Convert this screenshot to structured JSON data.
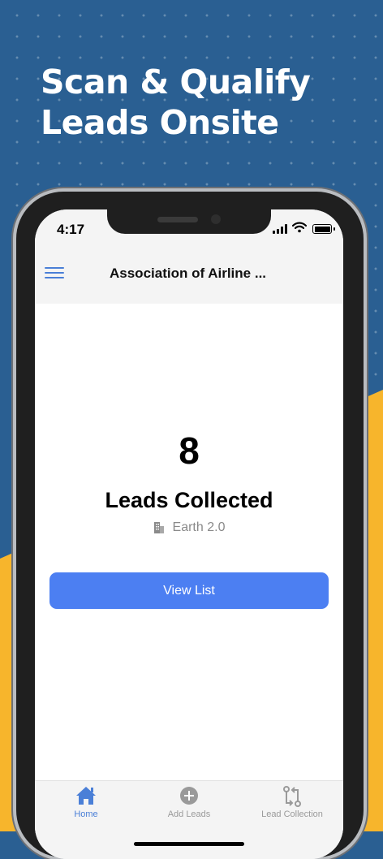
{
  "promo": {
    "headline_line1": "Scan & Qualify",
    "headline_line2": "Leads Onsite"
  },
  "status_bar": {
    "time": "4:17"
  },
  "nav": {
    "title": "Association of Airline ..."
  },
  "summary": {
    "count": "8",
    "label": "Leads Collected",
    "event_name": "Earth 2.0"
  },
  "actions": {
    "view_list_label": "View List"
  },
  "tabs": [
    {
      "label": "Home",
      "icon": "home-icon",
      "active": true
    },
    {
      "label": "Add Leads",
      "icon": "plus-circle-icon",
      "active": false
    },
    {
      "label": "Lead Collection",
      "icon": "sync-icon",
      "active": false
    }
  ],
  "colors": {
    "background_blue": "#2a5f92",
    "accent_yellow": "#f7b52c",
    "primary": "#4c7ff2"
  }
}
